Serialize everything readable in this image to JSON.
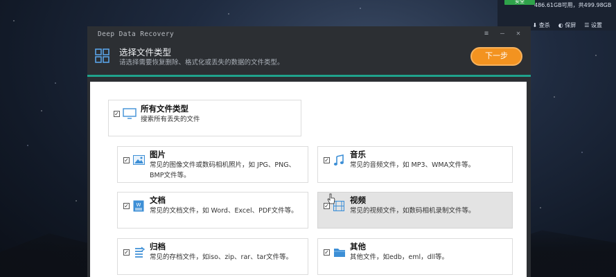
{
  "tray": {
    "safe_badge": "安全",
    "disk_info": "486.61GB可用，共499.98GB",
    "actions": [
      "查杀",
      "保屏",
      "设置"
    ]
  },
  "window": {
    "title": "Deep Data Recovery",
    "controls": [
      "≡",
      "—",
      "✕"
    ]
  },
  "header": {
    "title": "选择文件类型",
    "subtitle": "请选择需要恢复删除、格式化或丢失的数据的文件类型。",
    "next_button": "下一步"
  },
  "all_types": {
    "title": "所有文件类型",
    "desc": "搜索所有丢失的文件",
    "checked": true
  },
  "file_types": [
    {
      "title": "图片",
      "desc": "常见的图像文件或数码相机照片，如 JPG、PNG、BMP文件等。",
      "icon": "image-icon",
      "checked": true
    },
    {
      "title": "音乐",
      "desc": "常见的音频文件，如 MP3、WMA文件等。",
      "icon": "music-note-icon",
      "checked": true
    },
    {
      "title": "文档",
      "desc": "常见的文档文件，如 Word、Excel、PDF文件等。",
      "icon": "word-document-icon",
      "checked": true
    },
    {
      "title": "视频",
      "desc": "常见的视频文件，如数码相机录制文件等。",
      "icon": "film-icon",
      "checked": true
    },
    {
      "title": "归档",
      "desc": "常见的存档文件，如iso、zip、rar、tar文件等。",
      "icon": "archive-icon",
      "checked": true
    },
    {
      "title": "其他",
      "desc": "其他文件，如edb，eml，dll等。",
      "icon": "folder-icon",
      "checked": true
    }
  ],
  "colors": {
    "accent_orange": "#f39320",
    "accent_teal": "#1fa38c",
    "window_bg": "#2c2f33"
  }
}
